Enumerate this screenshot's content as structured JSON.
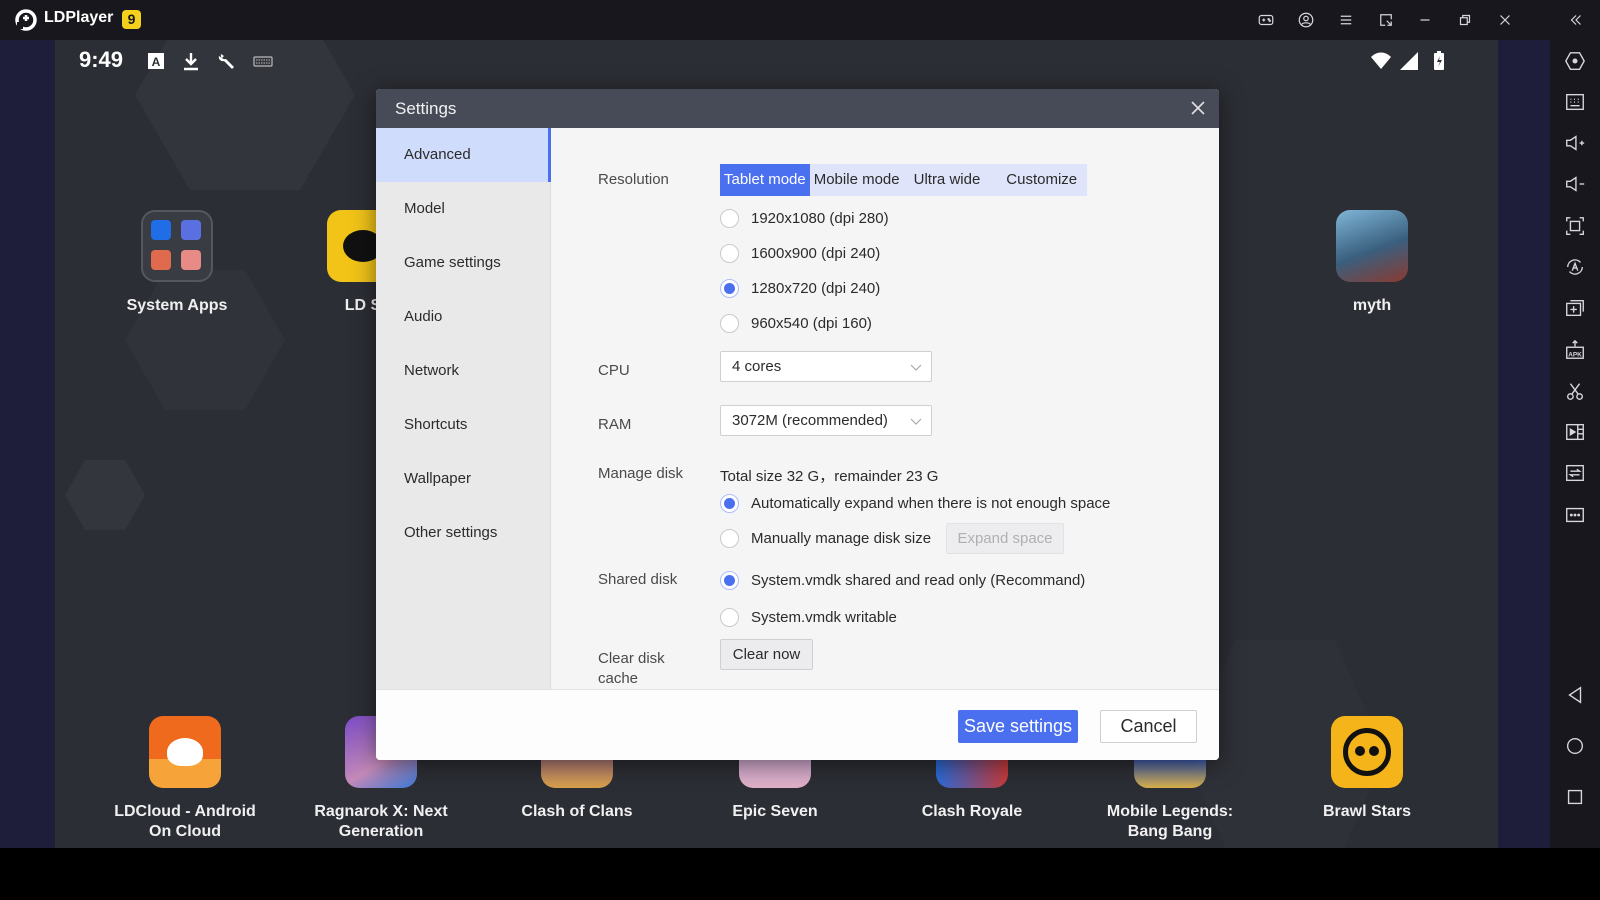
{
  "window": {
    "app_name": "LDPlayer",
    "version_badge": "9",
    "titlebar_icons": [
      "gamepad-icon",
      "account-icon",
      "menu-icon",
      "screen-rotate-icon",
      "minimize-icon",
      "restore-icon",
      "close-icon",
      "collapse-sidebar-icon"
    ]
  },
  "android_status": {
    "time": "9:49",
    "left_icons": [
      "font-a-icon",
      "download-icon",
      "wrench-icon",
      "keyboard-icon"
    ],
    "right_icons": [
      "wifi-icon",
      "signal-icon",
      "battery-charging-icon"
    ]
  },
  "sidebar_tools": [
    {
      "name": "settings-hex-icon"
    },
    {
      "name": "keyboard-mapping-icon"
    },
    {
      "name": "volume-up-icon"
    },
    {
      "name": "volume-down-icon"
    },
    {
      "name": "fullscreen-icon"
    },
    {
      "name": "auto-rotate-icon"
    },
    {
      "name": "multi-instance-add-icon"
    },
    {
      "name": "install-apk-icon"
    },
    {
      "name": "scissors-icon"
    },
    {
      "name": "record-video-icon"
    },
    {
      "name": "sync-icon"
    },
    {
      "name": "more-icon"
    }
  ],
  "nav_buttons": [
    "back-icon",
    "home-icon",
    "recents-icon"
  ],
  "desktop": {
    "top_apps": [
      {
        "label": "System Apps"
      },
      {
        "label": "LD S"
      },
      {
        "label": "myth"
      }
    ],
    "bottom_apps": [
      {
        "label": "LDCloud - Android On Cloud"
      },
      {
        "label": "Ragnarok X: Next Generation"
      },
      {
        "label": "Clash of Clans"
      },
      {
        "label": "Epic Seven"
      },
      {
        "label": "Clash Royale"
      },
      {
        "label": "Mobile Legends: Bang Bang"
      },
      {
        "label": "Brawl Stars"
      }
    ]
  },
  "settings": {
    "title": "Settings",
    "nav": [
      {
        "label": "Advanced",
        "active": true
      },
      {
        "label": "Model"
      },
      {
        "label": "Game settings"
      },
      {
        "label": "Audio"
      },
      {
        "label": "Network"
      },
      {
        "label": "Shortcuts"
      },
      {
        "label": "Wallpaper"
      },
      {
        "label": "Other settings"
      }
    ],
    "resolution": {
      "label": "Resolution",
      "modes": [
        "Tablet mode",
        "Mobile mode",
        "Ultra wide",
        "Customize"
      ],
      "active_mode": "Tablet mode",
      "options": [
        {
          "label": "1920x1080  (dpi 280)",
          "checked": false
        },
        {
          "label": "1600x900  (dpi 240)",
          "checked": false
        },
        {
          "label": "1280x720  (dpi 240)",
          "checked": true
        },
        {
          "label": "960x540  (dpi 160)",
          "checked": false
        }
      ]
    },
    "cpu": {
      "label": "CPU",
      "value": "4 cores"
    },
    "ram": {
      "label": "RAM",
      "value": "3072M (recommended)"
    },
    "manage_disk": {
      "label": "Manage disk",
      "info": "Total size 32 G，remainder 23 G",
      "options": [
        {
          "label": "Automatically expand when there is not enough space",
          "checked": true
        },
        {
          "label": "Manually manage disk size",
          "checked": false
        }
      ],
      "expand_button": "Expand space"
    },
    "shared_disk": {
      "label": "Shared disk",
      "options": [
        {
          "label": "System.vmdk shared and read only (Recommand)",
          "checked": true
        },
        {
          "label": "System.vmdk writable",
          "checked": false
        }
      ]
    },
    "clear_cache": {
      "label_line1": "Clear disk",
      "label_line2": "cache",
      "button": "Clear now"
    },
    "save_button": "Save settings",
    "cancel_button": "Cancel"
  },
  "colors": {
    "accent": "#4a70f0",
    "titlebar": "#17171d",
    "dialog_header": "#474a57",
    "nav_active_bg": "#cfdcfc",
    "badge": "#f5d01c"
  }
}
